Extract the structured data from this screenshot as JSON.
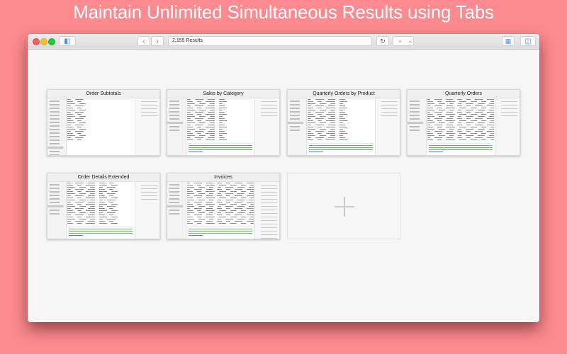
{
  "headline": "Maintain Unlimited Simultaneous Results using Tabs",
  "toolbar": {
    "search_value": "2,155 Results",
    "icons": {
      "sidebar": "sidebar-toggle-icon",
      "back": "chevron-left-icon",
      "forward": "chevron-right-icon",
      "reload": "reload-icon",
      "stop": "stop-icon",
      "menu": "chevron-down-icon",
      "grid": "tab-overview-icon",
      "panel": "inspector-panel-icon"
    },
    "glyphs": {
      "back": "‹",
      "forward": "›",
      "reload": "↻",
      "stop": "●",
      "menu": "⌄",
      "grid": "▦",
      "panel": "◫",
      "sidebar": "◧"
    }
  },
  "tabs": [
    {
      "title": "Order Subtotals"
    },
    {
      "title": "Sales by Category"
    },
    {
      "title": "Quarterly Orders by Product"
    },
    {
      "title": "Quarterly Orders"
    },
    {
      "title": "Order Details Extended"
    },
    {
      "title": "Invoices"
    }
  ],
  "new_tab": {
    "icon": "plus-icon"
  },
  "colors": {
    "background": "#fd8a8f",
    "close": "#fc5f57",
    "minimize": "#fdbc2e",
    "maximize": "#28c840",
    "log_text": "#6bb36b",
    "log_link": "#5c7cd6"
  }
}
